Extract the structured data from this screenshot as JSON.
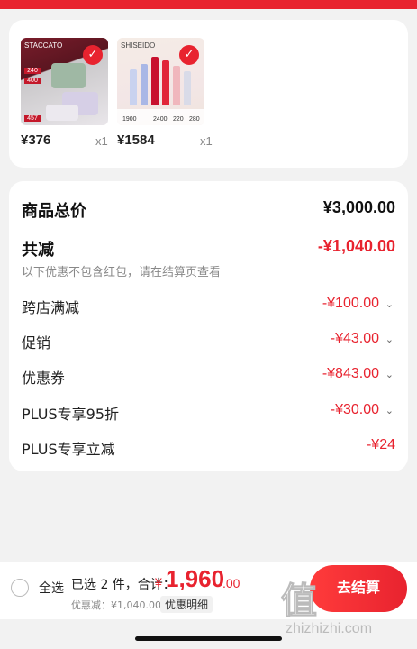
{
  "products": [
    {
      "brand": "STACCATO",
      "price_tags": [
        "240",
        "400",
        "457"
      ],
      "price": "¥376",
      "qty": "x1"
    },
    {
      "brand": "SHISEIDO",
      "price_tags": [
        "1900",
        "2400",
        "220",
        "280"
      ],
      "price": "¥1584",
      "qty": "x1"
    }
  ],
  "summary": {
    "goods_total_label": "商品总价",
    "goods_total_value": "¥3,000.00",
    "reduce_label": "共减",
    "reduce_value": "-¥1,040.00",
    "reduce_note": "以下优惠不包含红包，请在结算页查看",
    "items": [
      {
        "label": "跨店满减",
        "value": "-¥100.00"
      },
      {
        "label": "促销",
        "value": "-¥43.00"
      },
      {
        "label": "优惠券",
        "value": "-¥843.00"
      },
      {
        "label": "PLUS专享95折",
        "value": "-¥30.00"
      },
      {
        "label": "PLUS专享立减",
        "value": "-¥24"
      }
    ]
  },
  "bottom": {
    "select_all": "全选",
    "selected": "已选 2 件，合计：",
    "currency": "¥",
    "total_int": "1,960",
    "total_dec": ".00",
    "discount": "优惠减：¥1,040.00",
    "detail": "优惠明细",
    "checkout": "去结算"
  },
  "watermark": {
    "logo": "值",
    "url": "zhizhizhi.com"
  },
  "colors": {
    "accent": "#e8232f"
  }
}
